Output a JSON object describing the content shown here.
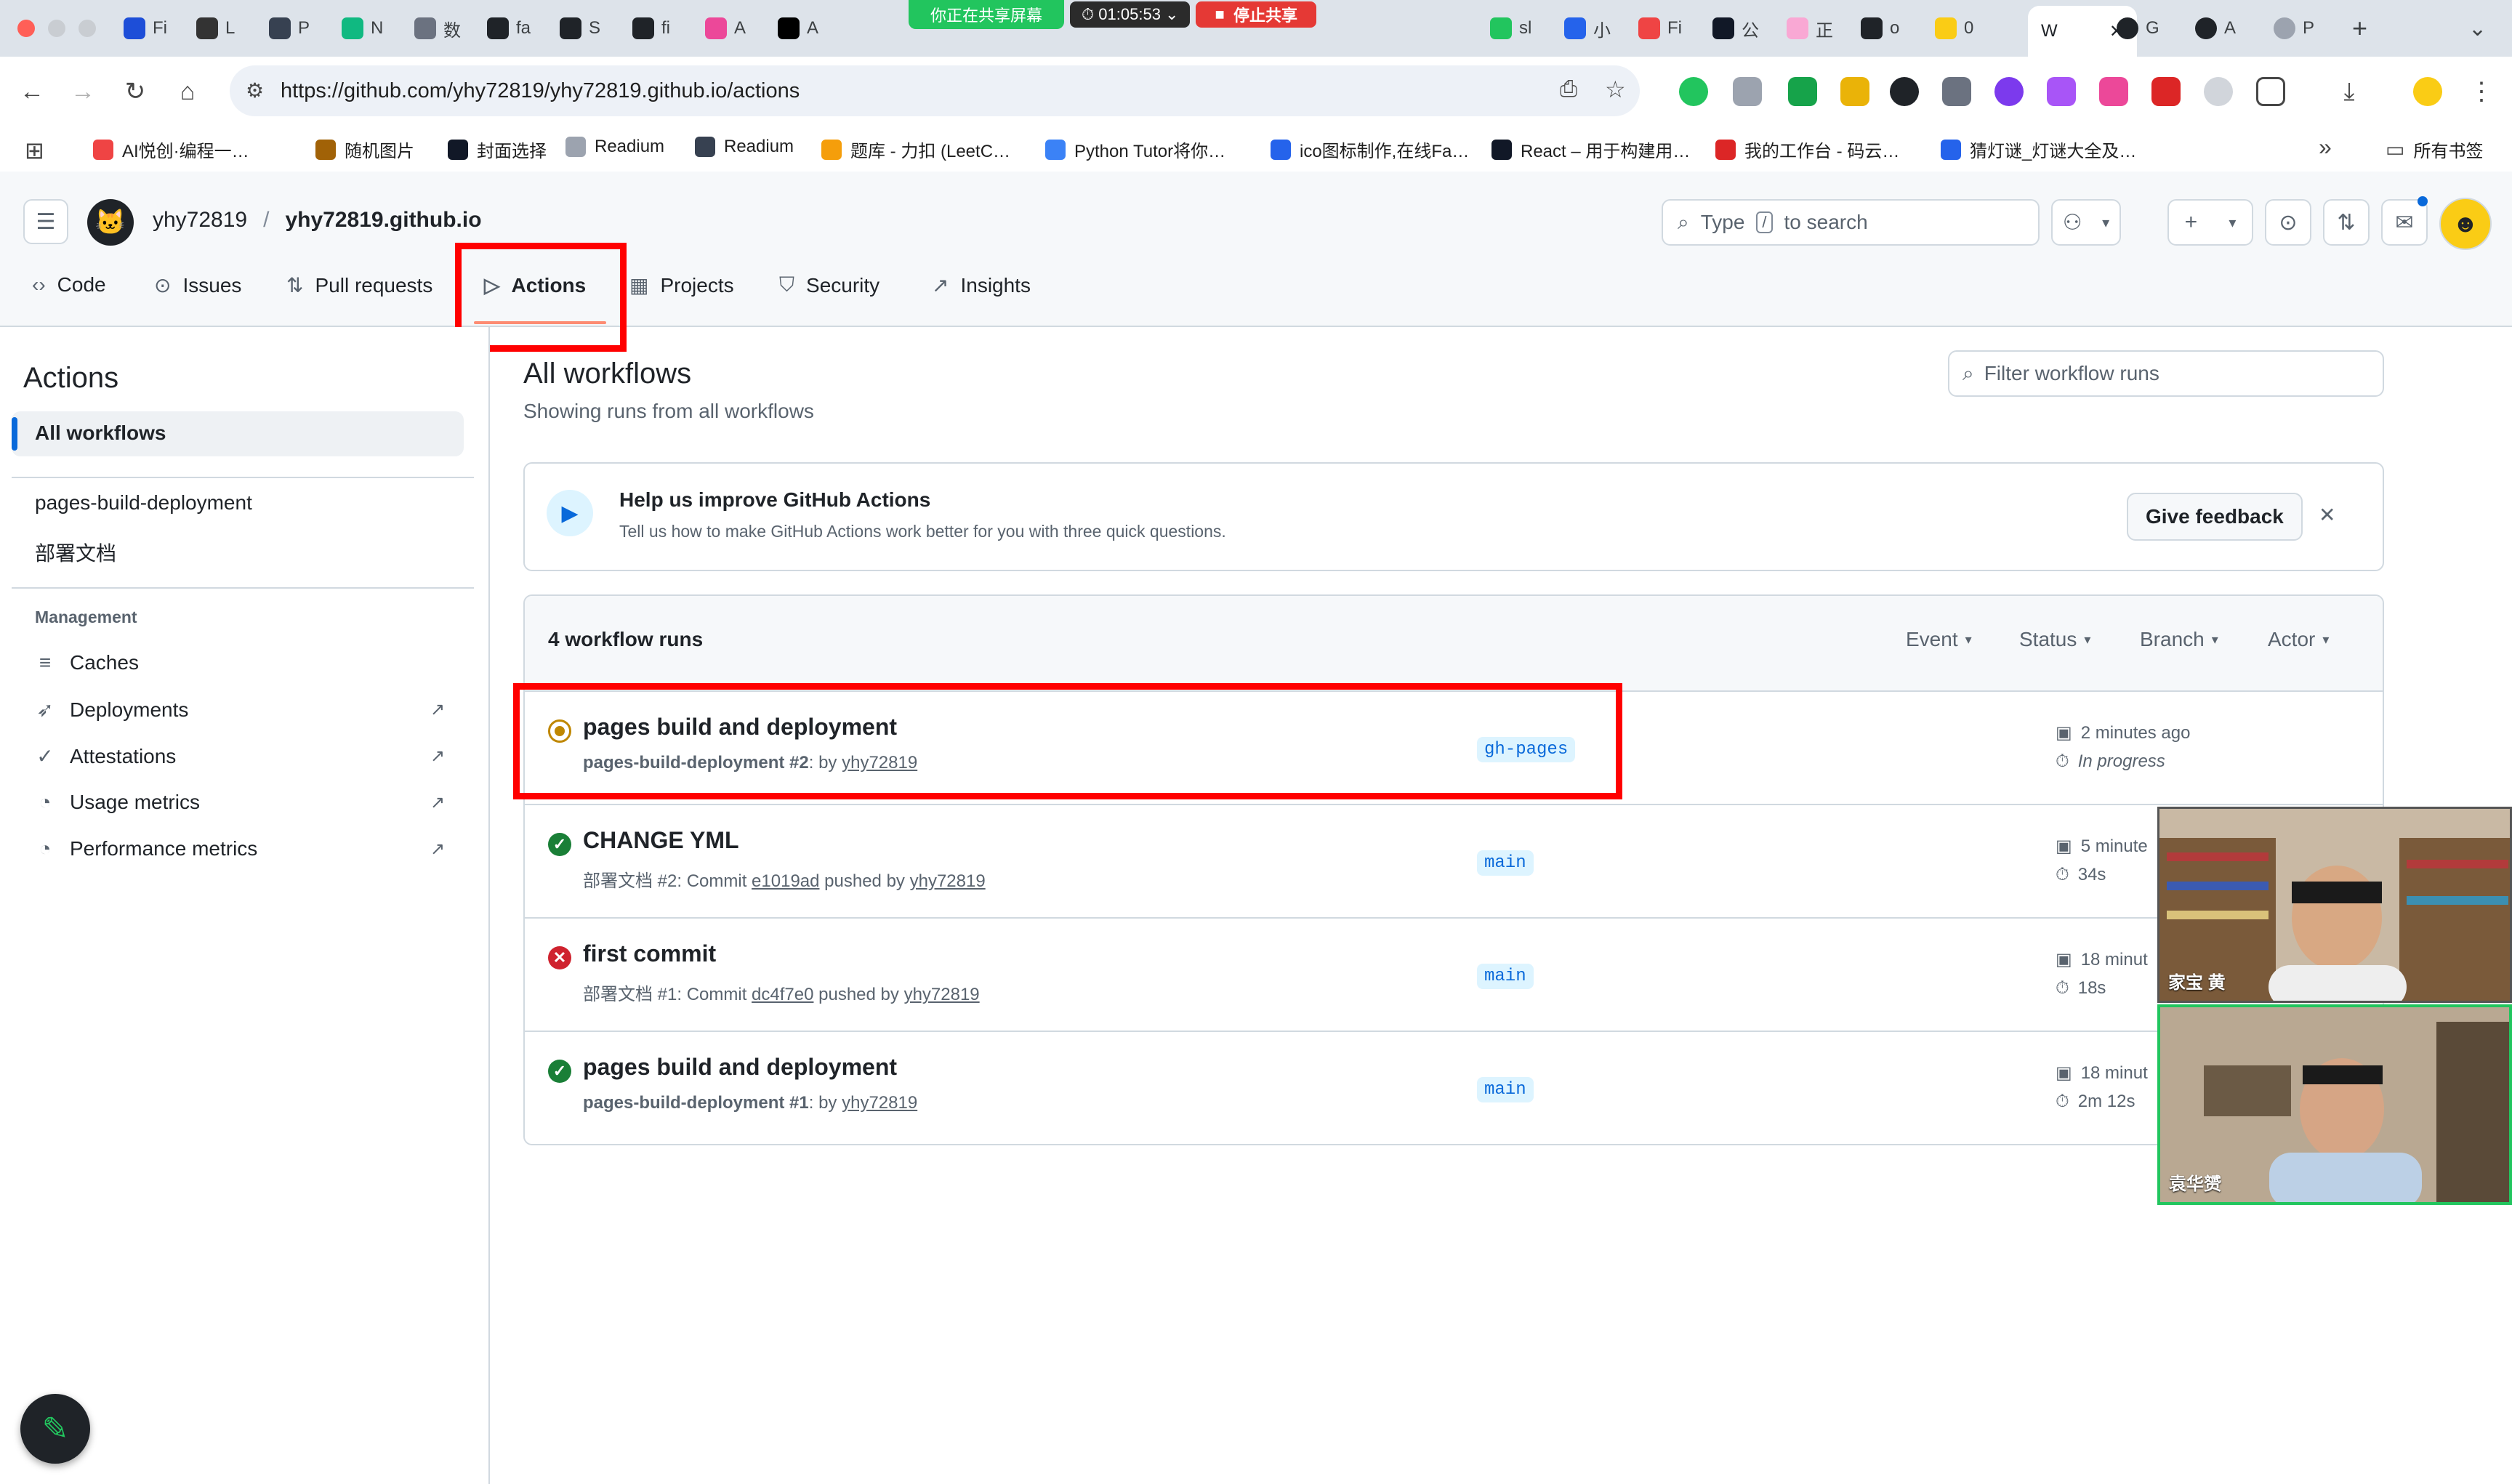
{
  "browser": {
    "tabs": [
      {
        "label": "Fi",
        "icon": "tab-favicon-1",
        "color": "#1d4ed8"
      },
      {
        "label": "L",
        "icon": "tab-favicon-2",
        "color": "#333333"
      },
      {
        "label": "P",
        "icon": "tab-favicon-3",
        "color": "#374151"
      },
      {
        "label": "N",
        "icon": "tab-favicon-4",
        "color": "#10b981"
      },
      {
        "label": "数",
        "icon": "tab-favicon-5",
        "color": "#6b7280"
      },
      {
        "label": "fa",
        "icon": "github-icon",
        "color": "#1f2328"
      },
      {
        "label": "S",
        "icon": "github-icon",
        "color": "#1f2328"
      },
      {
        "label": "fi",
        "icon": "github-icon",
        "color": "#1f2328"
      },
      {
        "label": "A",
        "icon": "tab-favicon-9",
        "color": "#ec4899"
      },
      {
        "label": "A",
        "icon": "medium-icon",
        "color": "#000000"
      }
    ],
    "tabs_right": [
      {
        "label": "sl",
        "icon": "tab-favicon-r1",
        "color": "#22c55e"
      },
      {
        "label": "小",
        "icon": "tab-favicon-r2",
        "color": "#2563eb"
      },
      {
        "label": "Fi",
        "icon": "tab-favicon-r3",
        "color": "#ef4444"
      },
      {
        "label": "公",
        "icon": "tab-favicon-r4",
        "color": "#111827"
      },
      {
        "label": "正",
        "icon": "tab-favicon-r5",
        "color": "#f9a8d4"
      },
      {
        "label": "o",
        "icon": "github-icon",
        "color": "#1f2328"
      },
      {
        "label": "0",
        "icon": "emoji-icon",
        "color": "#facc15"
      }
    ],
    "active_tab": {
      "label": "W",
      "close": "✕"
    },
    "tabs_after": [
      {
        "label": "G",
        "icon": "github-icon",
        "color": "#1f2328"
      },
      {
        "label": "A",
        "icon": "github-icon",
        "color": "#1f2328"
      },
      {
        "label": "P",
        "icon": "tab-favicon-a3",
        "color": "#9ca3af"
      }
    ],
    "new_tab": "+",
    "screen_share": {
      "message": "你正在共享屏幕",
      "timer": "01:05:53",
      "stop_label": "停止共享"
    },
    "url": "https://github.com/yhy72819/yhy72819.github.io/actions",
    "bookmarks": [
      {
        "label": "AI悦创·编程一…",
        "color": "#ef4444"
      },
      {
        "label": "随机图片",
        "color": "#a16207"
      },
      {
        "label": "封面选择",
        "color": "#111827"
      },
      {
        "label": "Readium",
        "color": "#9ca3af"
      },
      {
        "label": "Readium",
        "color": "#374151"
      },
      {
        "label": "题库 - 力扣 (LeetC…",
        "color": "#f59e0b"
      },
      {
        "label": "Python Tutor将你…",
        "color": "#3b82f6"
      },
      {
        "label": "ico图标制作,在线Fa…",
        "color": "#2563eb"
      },
      {
        "label": "React – 用于构建用…",
        "color": "#111827"
      },
      {
        "label": "我的工作台 - 码云…",
        "color": "#dc2626"
      },
      {
        "label": "猜灯谜_灯谜大全及…",
        "color": "#2563eb"
      }
    ],
    "bookmarks_more": "»",
    "all_bookmarks": "所有书签"
  },
  "github": {
    "owner": "yhy72819",
    "separator": "/",
    "repo": "yhy72819.github.io",
    "search_prefix": "Type",
    "search_key": "/",
    "search_suffix": "to search",
    "repo_nav": [
      {
        "label": "Code",
        "icon": "code-icon",
        "glyph": "‹›"
      },
      {
        "label": "Issues",
        "icon": "issue-icon",
        "glyph": "⊙"
      },
      {
        "label": "Pull requests",
        "icon": "pull-request-icon",
        "glyph": "⇅"
      },
      {
        "label": "Actions",
        "icon": "play-icon",
        "glyph": "▷"
      },
      {
        "label": "Projects",
        "icon": "table-icon",
        "glyph": "▦"
      },
      {
        "label": "Security",
        "icon": "shield-icon",
        "glyph": "⛉"
      },
      {
        "label": "Insights",
        "icon": "graph-icon",
        "glyph": "↗"
      }
    ]
  },
  "sidebar": {
    "title": "Actions",
    "all_workflows": "All workflows",
    "workflows": [
      "pages-build-deployment",
      "部署文档"
    ],
    "management_heading": "Management",
    "management": [
      {
        "label": "Caches",
        "icon": "database-icon",
        "glyph": "≡",
        "external": false
      },
      {
        "label": "Deployments",
        "icon": "rocket-icon",
        "glyph": "➶",
        "external": true
      },
      {
        "label": "Attestations",
        "icon": "verified-icon",
        "glyph": "✓",
        "external": true
      },
      {
        "label": "Usage metrics",
        "icon": "meter-icon",
        "glyph": "◔",
        "external": true
      },
      {
        "label": "Performance metrics",
        "icon": "meter-icon",
        "glyph": "◔",
        "external": true
      }
    ],
    "external_glyph": "↗"
  },
  "main": {
    "title": "All workflows",
    "subtitle": "Showing runs from all workflows",
    "filter_placeholder": "Filter workflow runs",
    "banner": {
      "title": "Help us improve GitHub Actions",
      "text": "Tell us how to make GitHub Actions work better for you with three quick questions.",
      "button": "Give feedback",
      "close": "✕"
    },
    "runs_count": "4 workflow runs",
    "filters": [
      "Event",
      "Status",
      "Branch",
      "Actor"
    ],
    "runs": [
      {
        "title": "pages build and deployment",
        "workflow": "pages-build-deployment",
        "run_number": "#2",
        "meta_mid": ": by",
        "commit": "",
        "user": "yhy72819",
        "branch": "gh-pages",
        "status": "in_progress",
        "status_color": "#bf8700",
        "time": "2 minutes ago",
        "duration": "In progress"
      },
      {
        "title": "CHANGE YML",
        "workflow": "部署文档",
        "run_number": "#2",
        "meta_mid": ": Commit",
        "commit": "e1019ad",
        "user": "yhy72819",
        "branch": "main",
        "status": "success",
        "status_color": "#1a7f37",
        "time": "5 minute",
        "duration": "34s"
      },
      {
        "title": "first commit",
        "workflow": "部署文档",
        "run_number": "#1",
        "meta_mid": ": Commit",
        "commit": "dc4f7e0",
        "user": "yhy72819",
        "branch": "main",
        "status": "failure",
        "status_color": "#cf222e",
        "time": "18 minut",
        "duration": "18s"
      },
      {
        "title": "pages build and deployment",
        "workflow": "pages-build-deployment",
        "run_number": "#1",
        "meta_mid": ": by",
        "commit": "",
        "user": "yhy72819",
        "branch": "main",
        "status": "success",
        "status_color": "#1a7f37",
        "time": "18 minut",
        "duration": "2m 12s"
      }
    ],
    "pushed_by": "pushed by"
  },
  "video_call": {
    "participants": [
      "家宝 黄",
      "袁华赟"
    ]
  },
  "colors": {
    "accent": "#0969da",
    "highlight": "#ff0000",
    "active_underline": "#fd8c73"
  }
}
